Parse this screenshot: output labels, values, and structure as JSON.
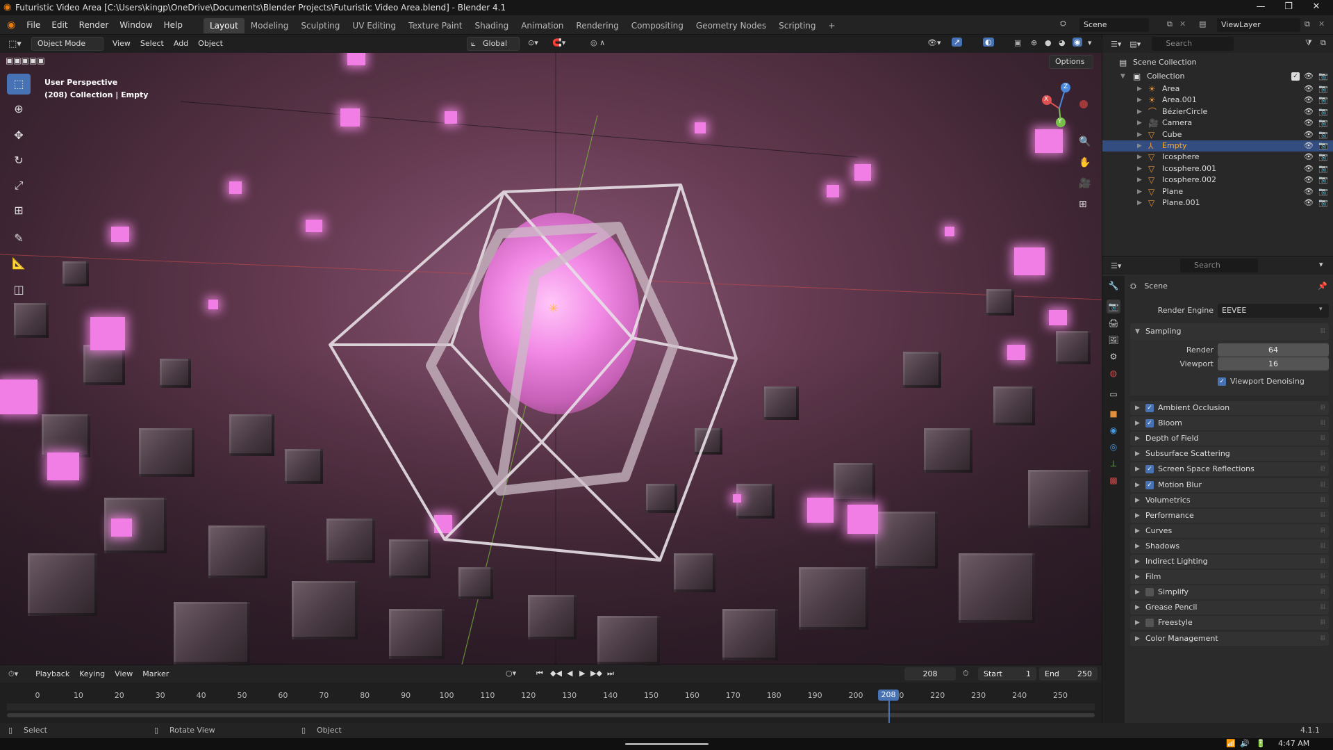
{
  "window": {
    "title": "Futuristic Video Area [C:\\Users\\kingp\\OneDrive\\Documents\\Blender Projects\\Futuristic Video Area.blend] - Blender 4.1",
    "minimize": "—",
    "maximize": "❐",
    "close": "✕"
  },
  "menus": [
    "File",
    "Edit",
    "Render",
    "Window",
    "Help"
  ],
  "workspaces": [
    "Layout",
    "Modeling",
    "Sculpting",
    "UV Editing",
    "Texture Paint",
    "Shading",
    "Animation",
    "Rendering",
    "Compositing",
    "Geometry Nodes",
    "Scripting"
  ],
  "workspace_add": "+",
  "scene_selector": "Scene",
  "viewlayer_selector": "ViewLayer",
  "viewport_header": {
    "mode": "Object Mode",
    "menus": [
      "View",
      "Select",
      "Add",
      "Object"
    ],
    "orientation": "Global",
    "options": "Options"
  },
  "viewport": {
    "overlay_line1": "User Perspective",
    "overlay_line2": "(208) Collection | Empty",
    "gizmo_x": "X",
    "gizmo_y": "Y",
    "gizmo_z": "Z"
  },
  "outliner": {
    "search_placeholder": "Search",
    "scene_collection": "Scene Collection",
    "collection": "Collection",
    "items": [
      {
        "name": "Area",
        "icon": "light-icon"
      },
      {
        "name": "Area.001",
        "icon": "light-icon"
      },
      {
        "name": "BézierCircle",
        "icon": "curve-icon"
      },
      {
        "name": "Camera",
        "icon": "camera-icon"
      },
      {
        "name": "Cube",
        "icon": "mesh-icon"
      },
      {
        "name": "Empty",
        "icon": "empty-icon",
        "selected": true
      },
      {
        "name": "Icosphere",
        "icon": "mesh-icon"
      },
      {
        "name": "Icosphere.001",
        "icon": "mesh-icon"
      },
      {
        "name": "Icosphere.002",
        "icon": "mesh-icon"
      },
      {
        "name": "Plane",
        "icon": "mesh-icon"
      },
      {
        "name": "Plane.001",
        "icon": "mesh-icon"
      }
    ]
  },
  "properties": {
    "search_placeholder": "Search",
    "context": "Scene",
    "render_engine_label": "Render Engine",
    "render_engine": "EEVEE",
    "sampling": {
      "title": "Sampling",
      "render_label": "Render",
      "render_value": "64",
      "viewport_label": "Viewport",
      "viewport_value": "16",
      "denoise_label": "Viewport Denoising"
    },
    "panels": [
      {
        "label": "Ambient Occlusion",
        "checkbox": true,
        "checked": true
      },
      {
        "label": "Bloom",
        "checkbox": true,
        "checked": true
      },
      {
        "label": "Depth of Field",
        "checkbox": false
      },
      {
        "label": "Subsurface Scattering",
        "checkbox": false
      },
      {
        "label": "Screen Space Reflections",
        "checkbox": true,
        "checked": true
      },
      {
        "label": "Motion Blur",
        "checkbox": true,
        "checked": true
      },
      {
        "label": "Volumetrics",
        "checkbox": false
      },
      {
        "label": "Performance",
        "checkbox": false
      },
      {
        "label": "Curves",
        "checkbox": false
      },
      {
        "label": "Shadows",
        "checkbox": false
      },
      {
        "label": "Indirect Lighting",
        "checkbox": false
      },
      {
        "label": "Film",
        "checkbox": false
      },
      {
        "label": "Simplify",
        "checkbox": true,
        "checked": false
      },
      {
        "label": "Grease Pencil",
        "checkbox": false
      },
      {
        "label": "Freestyle",
        "checkbox": true,
        "checked": false
      },
      {
        "label": "Color Management",
        "checkbox": false
      }
    ]
  },
  "timeline": {
    "menus": [
      "Playback",
      "Keying",
      "View",
      "Marker"
    ],
    "current_frame": "208",
    "start_label": "Start",
    "start_value": "1",
    "end_label": "End",
    "end_value": "250",
    "ticks": [
      "0",
      "10",
      "20",
      "30",
      "40",
      "50",
      "60",
      "70",
      "80",
      "90",
      "100",
      "110",
      "120",
      "130",
      "140",
      "150",
      "160",
      "170",
      "180",
      "190",
      "200",
      "210",
      "220",
      "230",
      "240",
      "250"
    ]
  },
  "statusbar": {
    "select": "Select",
    "rotate": "Rotate View",
    "object": "Object",
    "version": "4.1.1"
  },
  "taskbar": {
    "time": "4:47 AM"
  }
}
